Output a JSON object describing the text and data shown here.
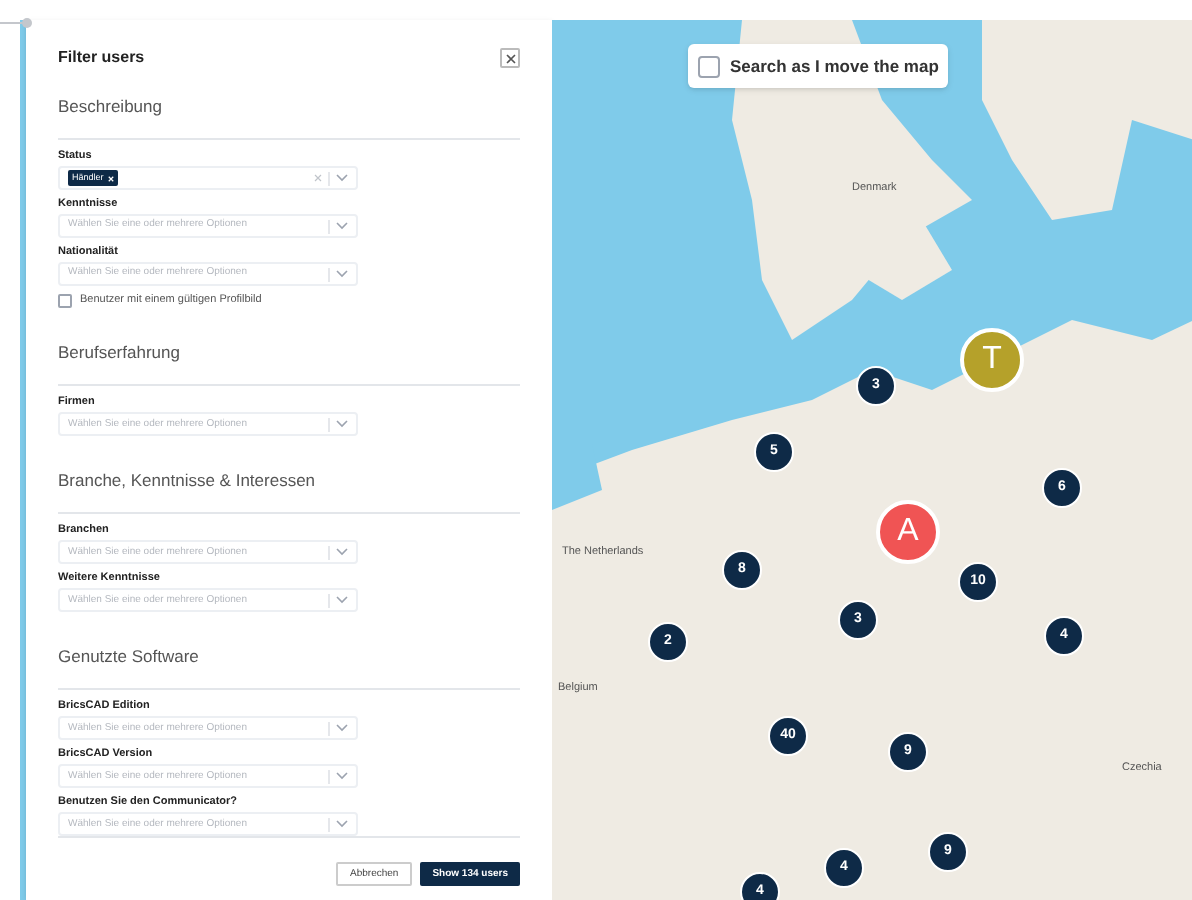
{
  "dialog": {
    "title": "Filter users"
  },
  "sections": [
    {
      "heading": "Beschreibung",
      "fields": [
        {
          "kind": "select",
          "label": "Status",
          "tags": [
            "Händler"
          ]
        },
        {
          "kind": "select",
          "label": "Kenntnisse",
          "placeholder": "Wählen Sie eine oder mehrere Optionen"
        },
        {
          "kind": "select",
          "label": "Nationalität",
          "placeholder": "Wählen Sie eine oder mehrere Optionen"
        },
        {
          "kind": "checkbox",
          "label": "Benutzer mit einem gültigen Profilbild",
          "checked": false
        }
      ]
    },
    {
      "heading": "Berufserfahrung",
      "fields": [
        {
          "kind": "select",
          "label": "Firmen",
          "placeholder": "Wählen Sie eine oder mehrere Optionen"
        }
      ]
    },
    {
      "heading": "Branche, Kenntnisse & Interessen",
      "fields": [
        {
          "kind": "select",
          "label": "Branchen",
          "placeholder": "Wählen Sie eine oder mehrere Optionen"
        },
        {
          "kind": "select",
          "label": "Weitere Kenntnisse",
          "placeholder": "Wählen Sie eine oder mehrere Optionen"
        }
      ]
    },
    {
      "heading": "Genutzte Software",
      "fields": [
        {
          "kind": "select",
          "label": "BricsCAD Edition",
          "placeholder": "Wählen Sie eine oder mehrere Optionen"
        },
        {
          "kind": "select",
          "label": "BricsCAD Version",
          "placeholder": "Wählen Sie eine oder mehrere Optionen"
        },
        {
          "kind": "select",
          "label": "Benutzen Sie den Communicator?",
          "placeholder": "Wählen Sie eine oder mehrere Optionen"
        }
      ]
    }
  ],
  "buttons": [
    {
      "label": "Abbrechen",
      "kind": "secondary"
    },
    {
      "label": "Show 134 users",
      "kind": "primary"
    }
  ],
  "map": {
    "search_toggle": {
      "label": "Search as I move the map",
      "checked": false
    },
    "labels": [
      "Denmark",
      "The Netherlands",
      "Belgium",
      "Czechia"
    ],
    "markers": [
      {
        "kind": "cluster",
        "label": "3"
      },
      {
        "kind": "user",
        "label": "T",
        "color": "#b5a12a"
      },
      {
        "kind": "cluster",
        "label": "5"
      },
      {
        "kind": "cluster",
        "label": "6"
      },
      {
        "kind": "user",
        "label": "A",
        "color": "#f05454"
      },
      {
        "kind": "cluster",
        "label": "8"
      },
      {
        "kind": "cluster",
        "label": "10"
      },
      {
        "kind": "cluster",
        "label": "3"
      },
      {
        "kind": "cluster",
        "label": "2"
      },
      {
        "kind": "cluster",
        "label": "4"
      },
      {
        "kind": "cluster",
        "label": "40"
      },
      {
        "kind": "cluster",
        "label": "9"
      },
      {
        "kind": "cluster",
        "label": "9"
      },
      {
        "kind": "cluster",
        "label": "4"
      },
      {
        "kind": "cluster",
        "label": "4"
      }
    ]
  }
}
